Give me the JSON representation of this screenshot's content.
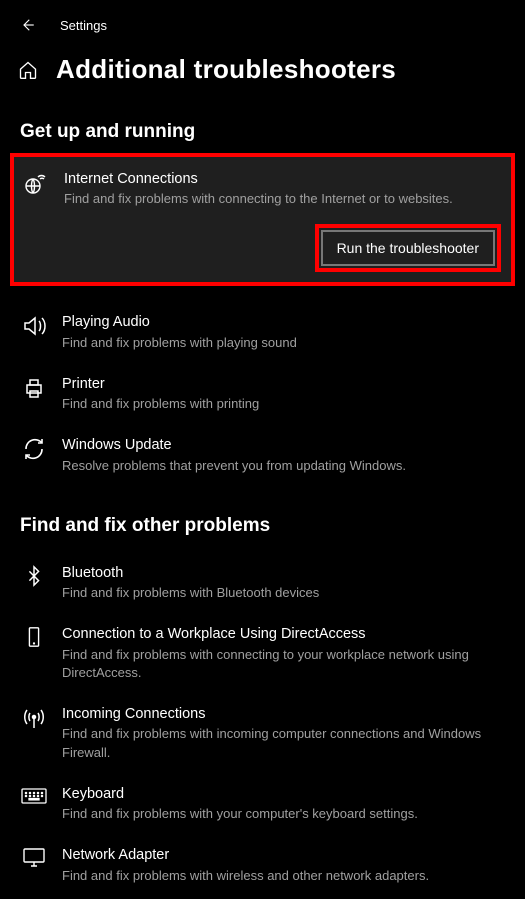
{
  "header": {
    "app_name": "Settings"
  },
  "page": {
    "title": "Additional troubleshooters"
  },
  "sections": {
    "running": {
      "title": "Get up and running",
      "items": [
        {
          "title": "Internet Connections",
          "desc": "Find and fix problems with connecting to the Internet or to websites."
        },
        {
          "title": "Playing Audio",
          "desc": "Find and fix problems with playing sound"
        },
        {
          "title": "Printer",
          "desc": "Find and fix problems with printing"
        },
        {
          "title": "Windows Update",
          "desc": "Resolve problems that prevent you from updating Windows."
        }
      ],
      "run_button_label": "Run the troubleshooter"
    },
    "other": {
      "title": "Find and fix other problems",
      "items": [
        {
          "title": "Bluetooth",
          "desc": "Find and fix problems with Bluetooth devices"
        },
        {
          "title": "Connection to a Workplace Using DirectAccess",
          "desc": "Find and fix problems with connecting to your workplace network using DirectAccess."
        },
        {
          "title": "Incoming Connections",
          "desc": "Find and fix problems with incoming computer connections and Windows Firewall."
        },
        {
          "title": "Keyboard",
          "desc": "Find and fix problems with your computer's keyboard settings."
        },
        {
          "title": "Network Adapter",
          "desc": "Find and fix problems with wireless and other network adapters."
        }
      ]
    }
  }
}
